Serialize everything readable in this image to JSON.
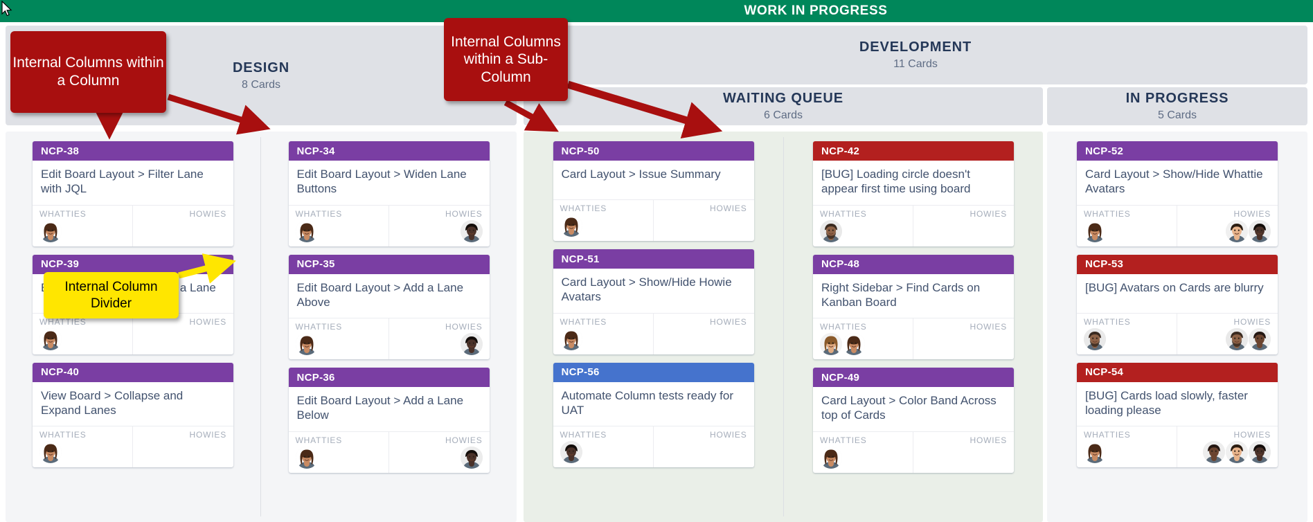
{
  "banner": {
    "title": "WORK IN PROGRESS",
    "color": "#00875a"
  },
  "cursor": {
    "icon": "mouse-pointer-icon"
  },
  "columns": [
    {
      "id": "design",
      "name": "DESIGN",
      "count": "8 Cards",
      "background": "#f4f5f7"
    },
    {
      "id": "development",
      "name": "DEVELOPMENT",
      "count": "11 Cards",
      "background": "#dfe1e6"
    },
    {
      "id": "waiting",
      "name": "WAITING QUEUE",
      "count": "6 Cards",
      "background": "#eaefe8"
    },
    {
      "id": "inprogress",
      "name": "IN PROGRESS",
      "count": "5 Cards",
      "background": "#f4f5f7"
    }
  ],
  "people_labels": {
    "left": "WHATTIES",
    "right": "HOWIES"
  },
  "callouts": [
    {
      "id": "internal-columns-within-column",
      "text": "Internal Columns within a Column",
      "style": "red",
      "color": "#a80f0f"
    },
    {
      "id": "internal-columns-within-subcolumn",
      "text": "Internal Columns within a Sub-Column",
      "style": "red",
      "color": "#a80f0f"
    },
    {
      "id": "internal-column-divider",
      "text": "Internal Column Divider",
      "style": "yellow",
      "color": "#ffe600"
    }
  ],
  "card_band_colors": {
    "purple": "#7a3ea3",
    "red": "#b3201f",
    "blue": "#4573cd"
  },
  "subcolumns": [
    {
      "id": "design-sub-a",
      "parent": "design",
      "cards": [
        {
          "key": "NCP-38",
          "band": "purple",
          "summary": "Edit Board Layout > Filter Lane with JQL",
          "whatties": [
            "woman-1"
          ],
          "howies": []
        },
        {
          "key": "NCP-39",
          "band": "purple",
          "summary": "Edit Board Layout > Move a Lane",
          "whatties": [
            "woman-1"
          ],
          "howies": []
        },
        {
          "key": "NCP-40",
          "band": "purple",
          "summary": "View Board > Collapse and Expand Lanes",
          "whatties": [
            "woman-1"
          ],
          "howies": []
        }
      ]
    },
    {
      "id": "design-sub-b",
      "parent": "design",
      "cards": [
        {
          "key": "NCP-34",
          "band": "purple",
          "summary": "Edit Board Layout > Widen Lane Buttons",
          "whatties": [
            "woman-1"
          ],
          "howies": [
            "man-dark-1"
          ]
        },
        {
          "key": "NCP-35",
          "band": "purple",
          "summary": "Edit Board Layout > Add a Lane Above",
          "whatties": [
            "woman-1"
          ],
          "howies": [
            "man-dark-1"
          ]
        },
        {
          "key": "NCP-36",
          "band": "purple",
          "summary": "Edit Board Layout > Add a Lane Below",
          "whatties": [
            "woman-1"
          ],
          "howies": [
            "man-dark-1"
          ]
        }
      ]
    },
    {
      "id": "waiting-sub-a",
      "parent": "waiting",
      "cards": [
        {
          "key": "NCP-50",
          "band": "purple",
          "summary": "Card Layout > Issue Summary",
          "whatties": [
            "woman-1"
          ],
          "howies": []
        },
        {
          "key": "NCP-51",
          "band": "purple",
          "summary": "Card Layout > Show/Hide Howie Avatars",
          "whatties": [
            "woman-1"
          ],
          "howies": []
        },
        {
          "key": "NCP-56",
          "band": "blue",
          "summary": "Automate Column tests ready for UAT",
          "whatties": [
            "man-dark-1"
          ],
          "howies": []
        }
      ]
    },
    {
      "id": "waiting-sub-b",
      "parent": "waiting",
      "cards": [
        {
          "key": "NCP-42",
          "band": "red",
          "summary": "[BUG] Loading circle doesn't appear first time using board",
          "whatties": [
            "man-beard-1"
          ],
          "howies": []
        },
        {
          "key": "NCP-48",
          "band": "purple",
          "summary": "Right Sidebar > Find Cards on Kanban Board",
          "whatties": [
            "woman-2",
            "woman-1"
          ],
          "howies": []
        },
        {
          "key": "NCP-49",
          "band": "purple",
          "summary": "Card Layout > Color Band Across top of Cards",
          "whatties": [
            "woman-1"
          ],
          "howies": []
        }
      ]
    },
    {
      "id": "inprogress-sub-a",
      "parent": "inprogress",
      "cards": [
        {
          "key": "NCP-52",
          "band": "purple",
          "summary": "Card Layout > Show/Hide Whattie Avatars",
          "whatties": [
            "woman-1"
          ],
          "howies": [
            "man-light-1",
            "man-dark-1"
          ]
        },
        {
          "key": "NCP-53",
          "band": "red",
          "summary": "[BUG] Avatars on Cards are blurry",
          "whatties": [
            "man-beard-1"
          ],
          "howies": [
            "man-beard-1",
            "man-brown-1"
          ]
        },
        {
          "key": "NCP-54",
          "band": "red",
          "summary": "[BUG] Cards load slowly, faster loading please",
          "whatties": [
            "woman-1"
          ],
          "howies": [
            "man-brown-1",
            "man-light-1",
            "man-dark-1"
          ]
        }
      ]
    }
  ]
}
